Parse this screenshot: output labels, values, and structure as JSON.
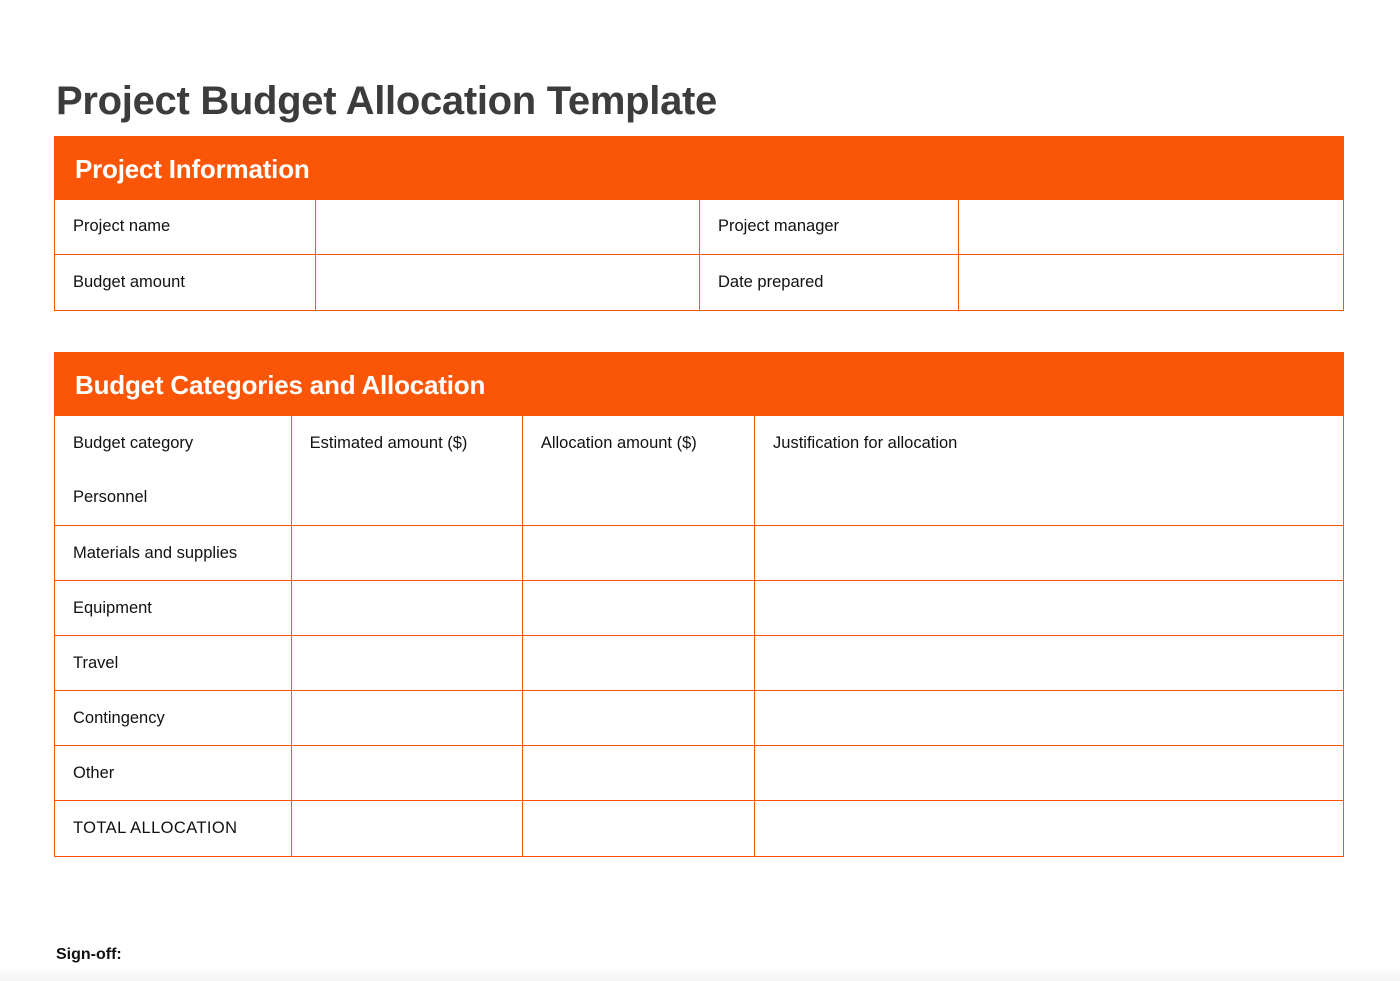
{
  "document": {
    "title": "Project Budget Allocation Template",
    "signoff_label": "Sign-off:"
  },
  "theme": {
    "accent": "#FB5607",
    "accent_soft": "#FDF0E5",
    "title_color": "#3C3C3C",
    "text_color": "#111111",
    "page_background": "#FFFFFF"
  },
  "project_information": {
    "heading": "Project Information",
    "rows": [
      {
        "label_left": "Project name",
        "value_left": "",
        "label_right": "Project manager",
        "value_right": ""
      },
      {
        "label_left": "Budget amount",
        "value_left": "",
        "label_right": "Date prepared",
        "value_right": ""
      }
    ]
  },
  "budget_categories": {
    "heading": "Budget Categories and Allocation",
    "columns": [
      "Budget category",
      "Estimated amount ($)",
      "Allocation amount ($)",
      "Justification for allocation"
    ],
    "rows": [
      {
        "category": "Personnel",
        "estimated": "",
        "allocation": "",
        "justification": ""
      },
      {
        "category": "Materials and supplies",
        "estimated": "",
        "allocation": "",
        "justification": ""
      },
      {
        "category": "Equipment",
        "estimated": "",
        "allocation": "",
        "justification": ""
      },
      {
        "category": "Travel",
        "estimated": "",
        "allocation": "",
        "justification": ""
      },
      {
        "category": "Contingency",
        "estimated": "",
        "allocation": "",
        "justification": ""
      },
      {
        "category": "Other",
        "estimated": "",
        "allocation": "",
        "justification": ""
      }
    ],
    "total_row": {
      "label": "TOTAL ALLOCATION",
      "estimated": "",
      "allocation": "",
      "justification": ""
    }
  }
}
